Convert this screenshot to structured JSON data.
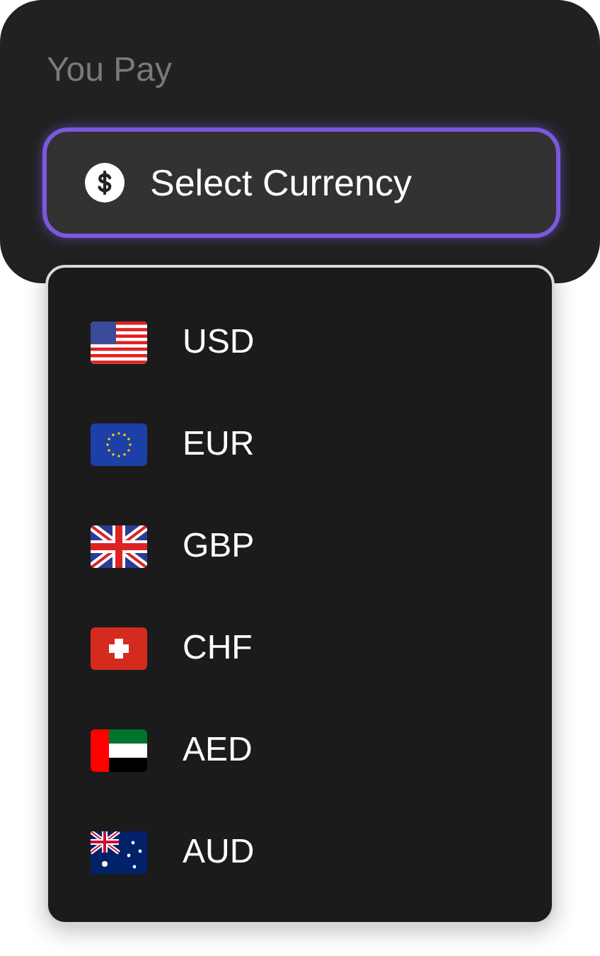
{
  "label": "You Pay",
  "select": {
    "placeholder": "Select Currency",
    "expanded": true
  },
  "menu": [
    {
      "code": "USD",
      "kind": "us"
    },
    {
      "code": "EUR",
      "kind": "eu"
    },
    {
      "code": "GBP",
      "kind": "gb"
    },
    {
      "code": "CHF",
      "kind": "ch"
    },
    {
      "code": "AED",
      "kind": "ae"
    },
    {
      "code": "AUD",
      "kind": "au"
    }
  ]
}
